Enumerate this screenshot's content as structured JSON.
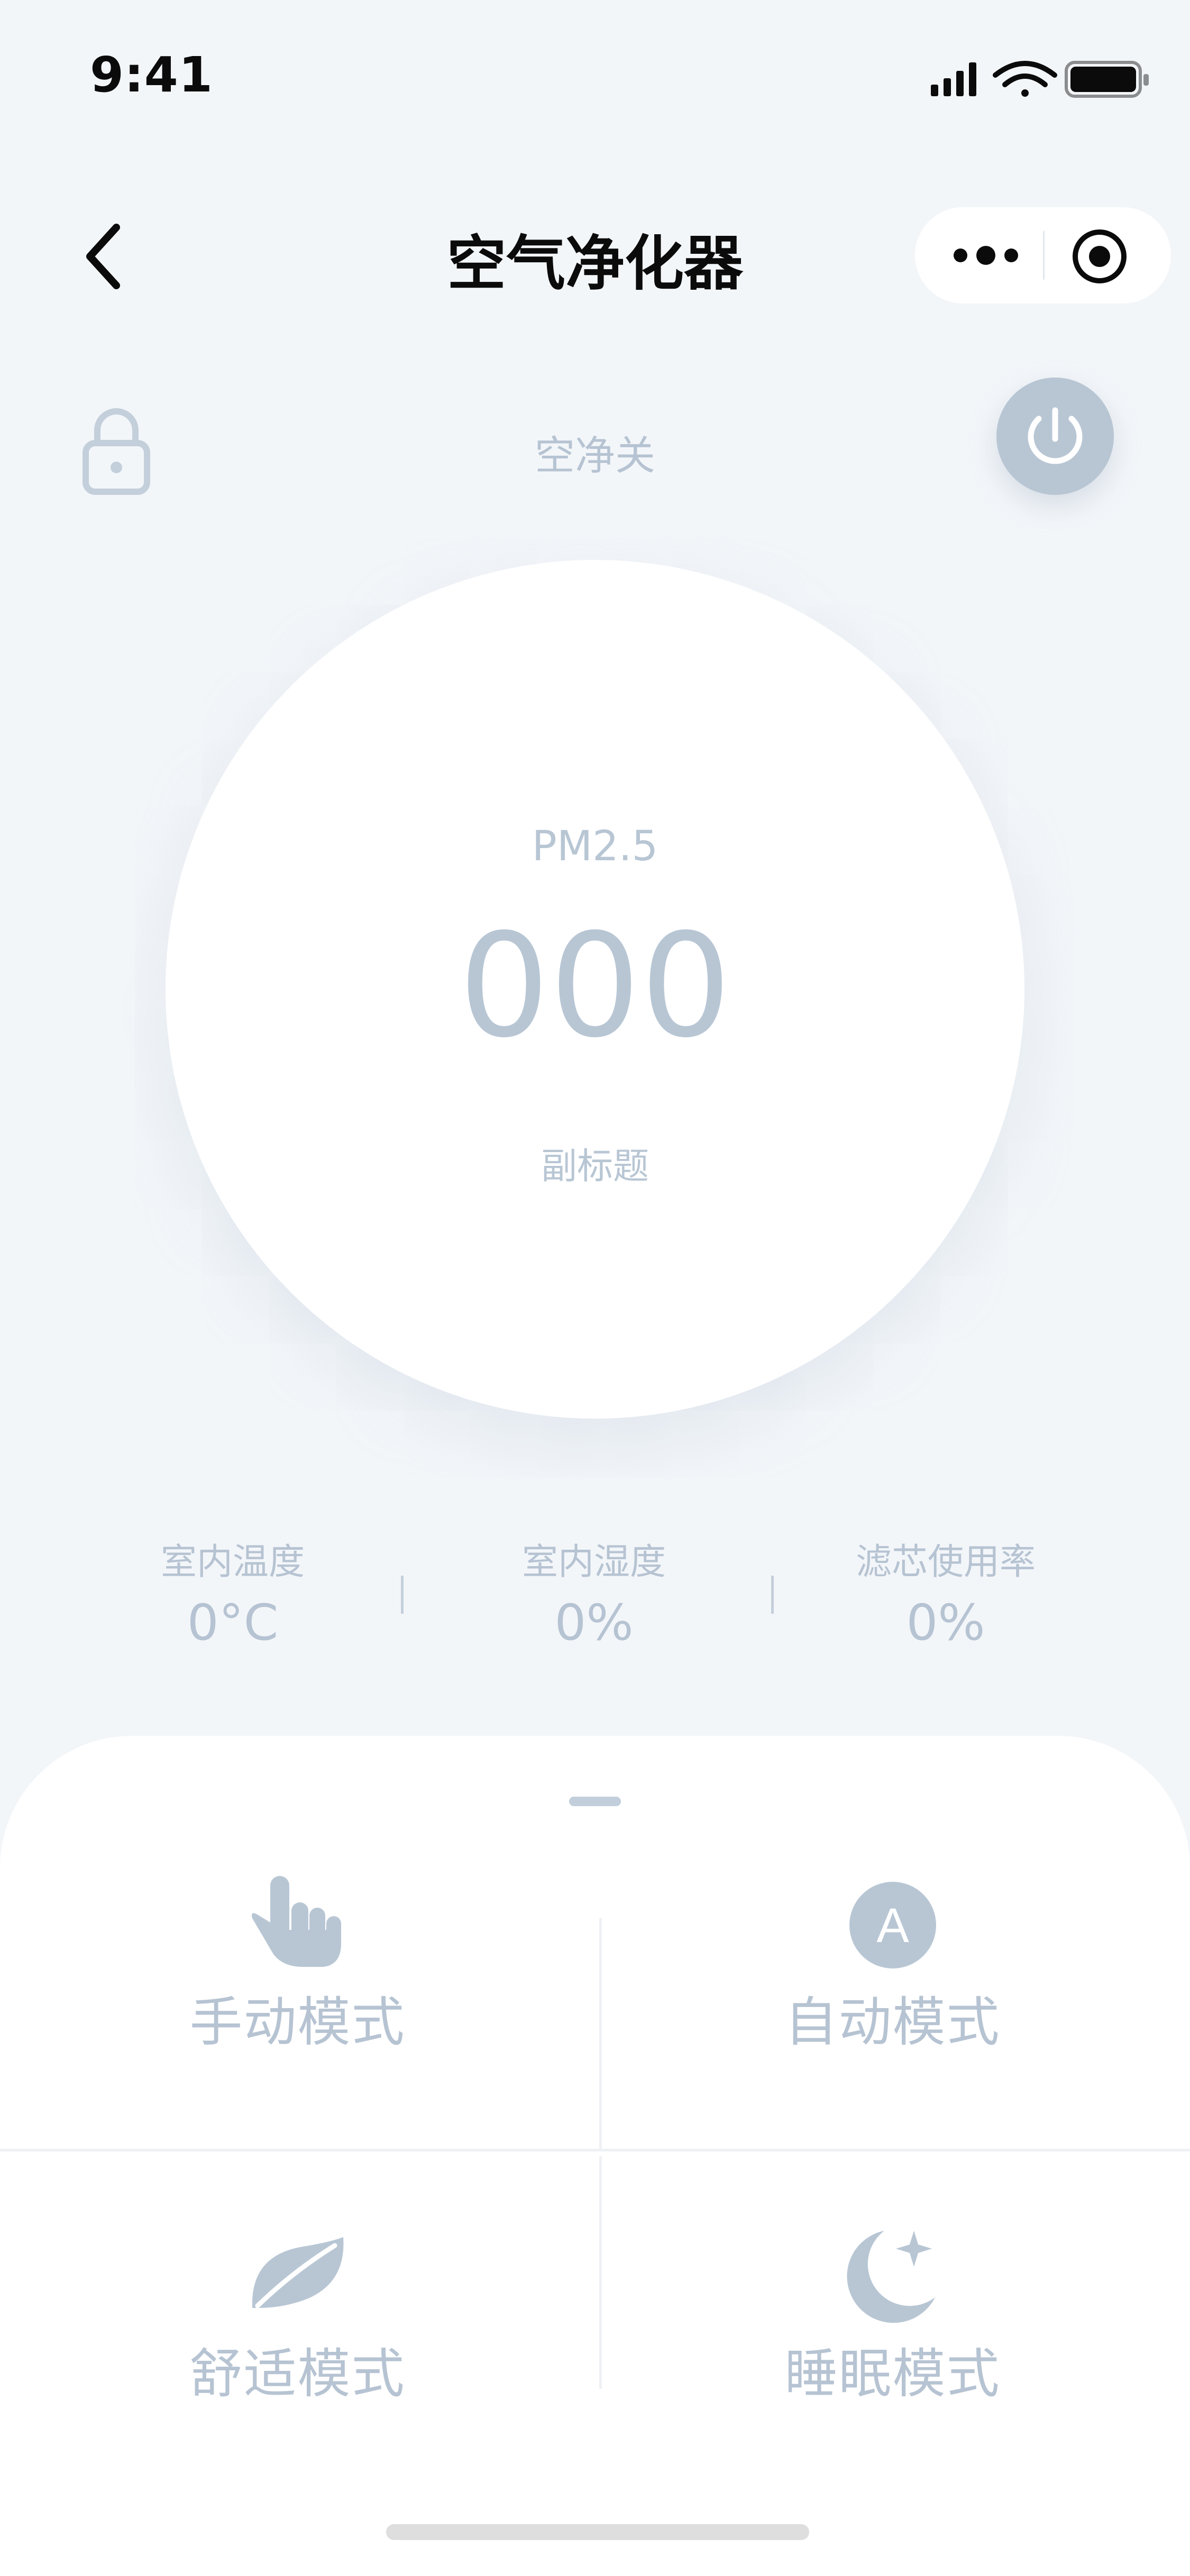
{
  "status_bar": {
    "time": "9:41"
  },
  "nav": {
    "title": "空气净化器"
  },
  "control": {
    "state_label": "空净关"
  },
  "gauge": {
    "label": "PM2.5",
    "value": "000",
    "subtitle": "副标题"
  },
  "stats": [
    {
      "label": "室内温度",
      "value": "0°C"
    },
    {
      "label": "室内湿度",
      "value": "0%"
    },
    {
      "label": "滤芯使用率",
      "value": "0%"
    }
  ],
  "modes": [
    {
      "label": "手动模式",
      "icon": "hand-pointer-icon"
    },
    {
      "label": "自动模式",
      "icon": "auto-a-icon",
      "icon_text": "A"
    },
    {
      "label": "舒适模式",
      "icon": "leaf-icon"
    },
    {
      "label": "睡眠模式",
      "icon": "moon-star-icon"
    }
  ],
  "colors": {
    "background": "#f3f6f9",
    "accent_muted": "#b8c6d4",
    "text_primary": "#0b0b0b",
    "card": "#ffffff"
  }
}
